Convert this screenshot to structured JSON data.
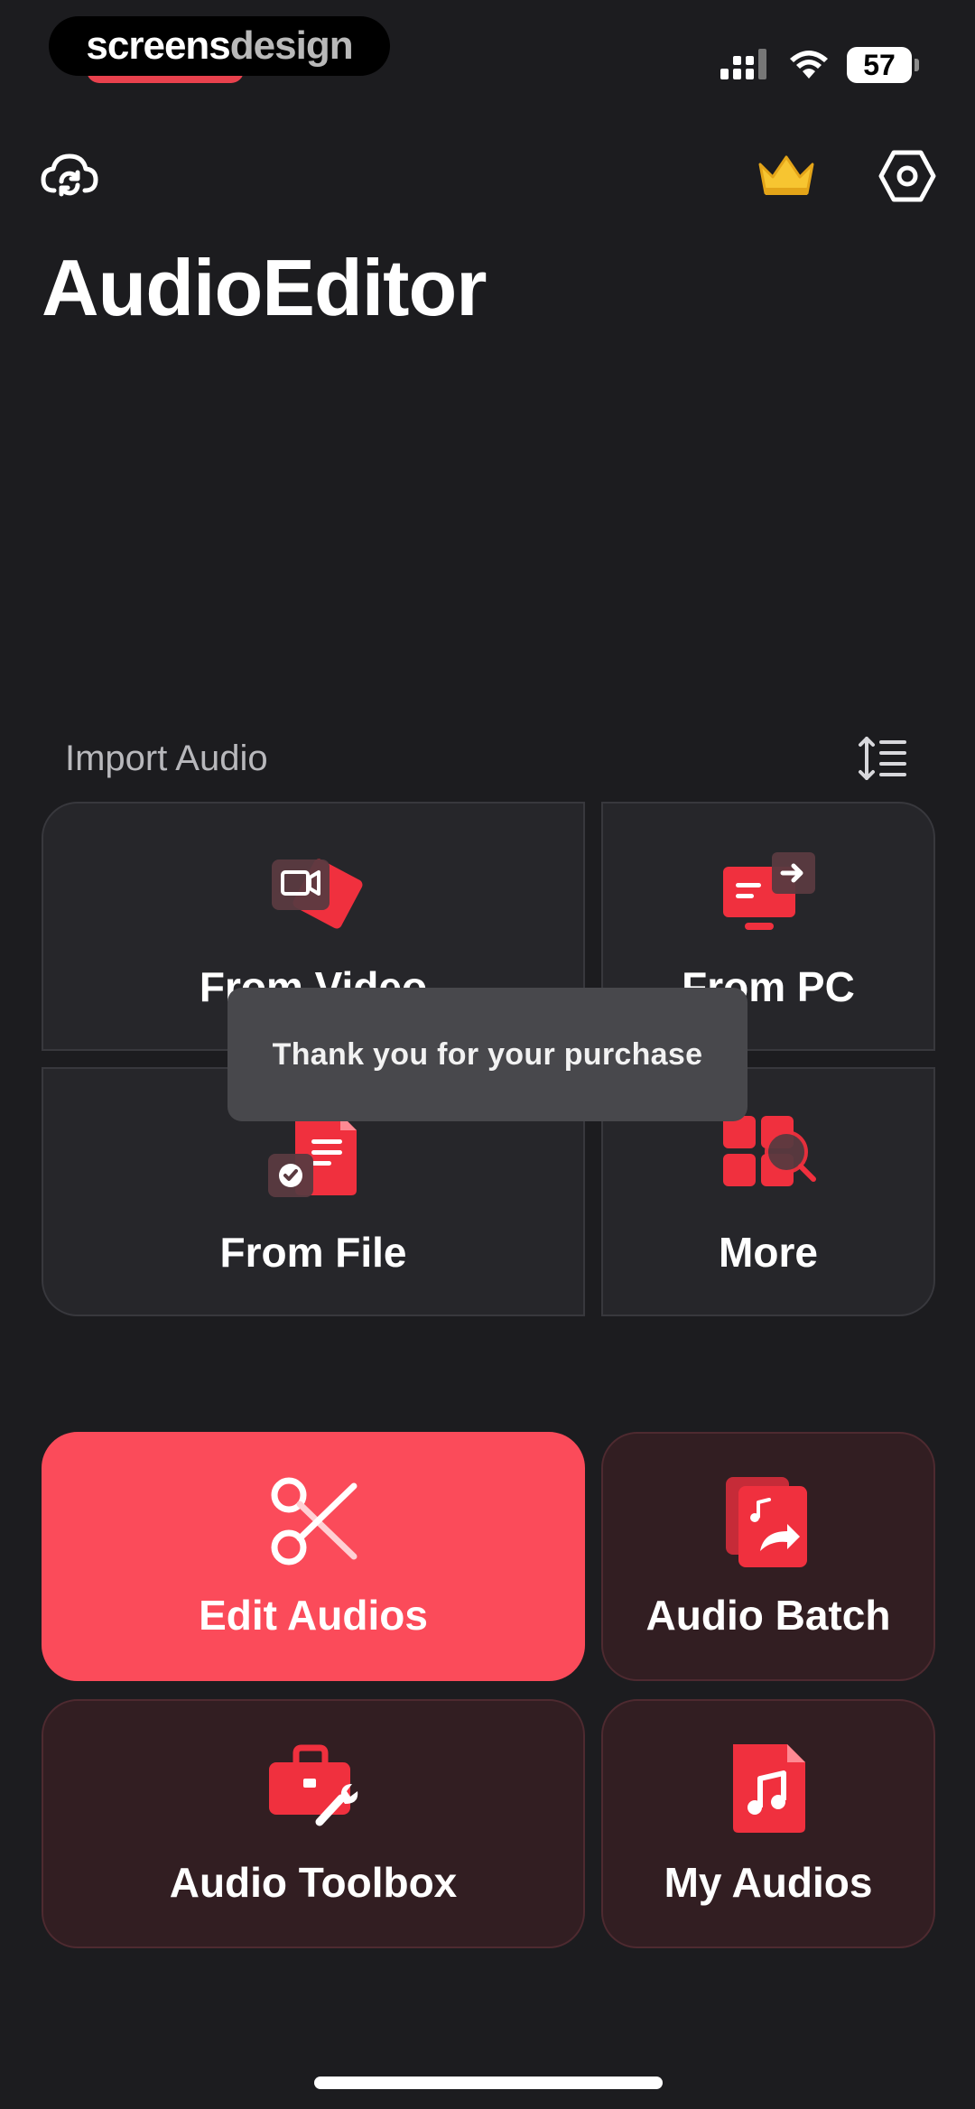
{
  "status_bar": {
    "watermark_part1": "screens",
    "watermark_part2": "design",
    "battery": "57",
    "icons": [
      "signal-icon",
      "wifi-icon",
      "battery-icon"
    ]
  },
  "header": {
    "title": "AudioEditor",
    "icons": [
      "cloud-sync-icon",
      "crown-icon",
      "settings-icon"
    ]
  },
  "import_section": {
    "label": "Import Audio",
    "cards": [
      {
        "label": "From Video",
        "icon": "video-icon"
      },
      {
        "label": "From PC",
        "icon": "pc-transfer-icon"
      },
      {
        "label": "From File",
        "icon": "file-icon"
      },
      {
        "label": "More",
        "icon": "more-grid-icon"
      }
    ]
  },
  "toast": {
    "message": "Thank you for your purchase"
  },
  "features": [
    {
      "label": "Edit Audios",
      "icon": "scissors-icon"
    },
    {
      "label": "Audio Batch",
      "icon": "audio-batch-icon"
    },
    {
      "label": "Audio Toolbox",
      "icon": "toolbox-icon"
    },
    {
      "label": "My Audios",
      "icon": "music-file-icon"
    }
  ],
  "colors": {
    "background": "#1c1c1f",
    "accent": "#fb4b5a",
    "card": "#26262a",
    "feature_card": "#321e22",
    "crown": "#f7c531"
  }
}
